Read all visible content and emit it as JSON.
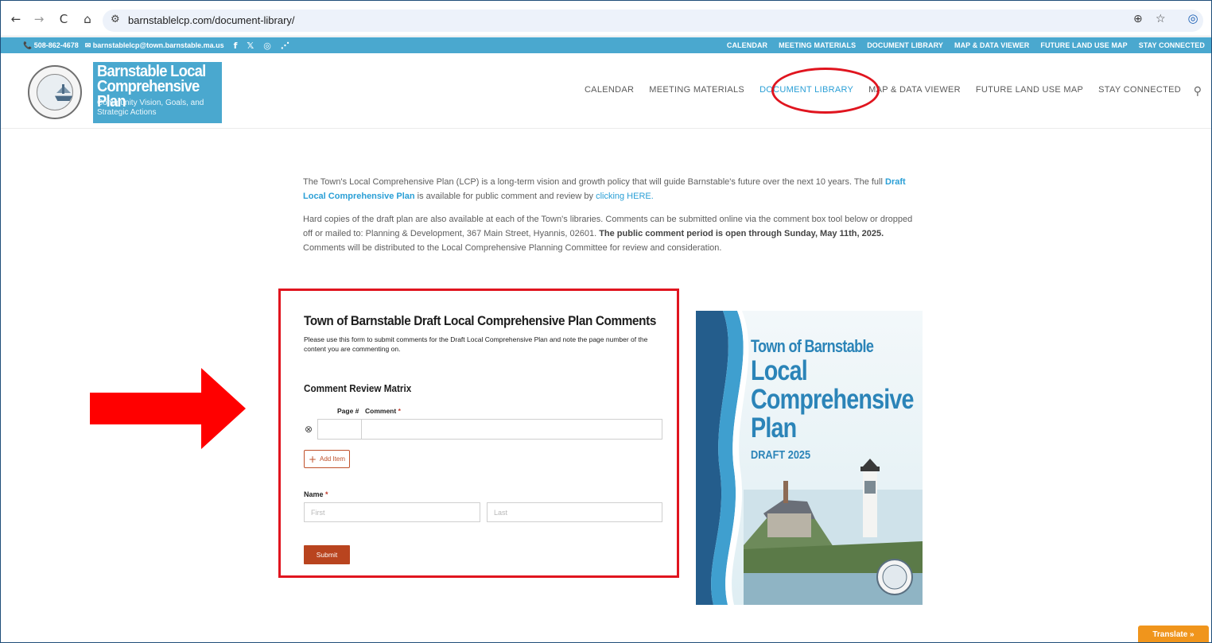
{
  "browser": {
    "url": "barnstablelcp.com/document-library/",
    "back_icon": "←",
    "forward_icon": "→",
    "reload_icon": "C",
    "home_icon": "⌂",
    "site_info_icon": "⚙",
    "zoom_icon": "⊕",
    "bookmark_icon": "☆",
    "profile_icon": "◎"
  },
  "topbar": {
    "phone": "📞 508-862-4678",
    "email": "✉ barnstablelcp@town.barnstable.ma.us",
    "social_facebook": "f",
    "social_x": "𝕏",
    "social_instagram": "◎",
    "social_rss": "⋰",
    "links": [
      "CALENDAR",
      "MEETING MATERIALS",
      "DOCUMENT LIBRARY",
      "MAP & DATA VIEWER",
      "FUTURE LAND USE MAP",
      "STAY CONNECTED"
    ]
  },
  "header": {
    "logo_title": "Barnstable Local Comprehensive Plan",
    "logo_subtitle": "Community Vision, Goals, and Strategic Actions",
    "nav": [
      "CALENDAR",
      "MEETING MATERIALS",
      "DOCUMENT LIBRARY",
      "MAP & DATA VIEWER",
      "FUTURE LAND USE MAP",
      "STAY CONNECTED"
    ],
    "active_nav": "DOCUMENT LIBRARY",
    "search_icon": "⚲"
  },
  "intro": {
    "p1_a": "The Town's Local Comprehensive Plan (LCP) is a long-term vision and growth policy that will guide Barnstable's future over the next 10 years. The full ",
    "p1_link": "Draft Local Comprehensive Plan",
    "p1_b": " is available for public comment and review by ",
    "p1_link2": "clicking HERE.",
    "p2_a": "Hard copies of the draft plan are also available at each of the Town's libraries. Comments can be submitted online via the comment box tool below or dropped off or mailed to: Planning & Development, 367 Main Street, Hyannis, 02601. ",
    "p2_bold": "The public comment period is open through Sunday, May 11th, 2025.",
    "p2_b": " Comments will be distributed to the Local Comprehensive Planning Committee for review and consideration."
  },
  "form": {
    "title": "Town of Barnstable Draft Local Comprehensive Plan Comments",
    "description": "Please use this form to submit comments for the Draft Local Comprehensive Plan and note the page number of the content you are commenting on.",
    "matrix_title": "Comment Review Matrix",
    "col_page": "Page #",
    "col_comment": "Comment",
    "required_mark": "*",
    "remove_icon": "⊗",
    "add_item_label": "Add Item",
    "add_item_icon": "+",
    "name_label": "Name",
    "first_placeholder": "First",
    "last_placeholder": "Last",
    "submit_label": "Submit"
  },
  "cover": {
    "town": "Town of Barnstable",
    "title_l1": "Local",
    "title_l2": "Comprehensive",
    "title_l3": "Plan",
    "draft": "DRAFT 2025"
  },
  "translate_label": "Translate »",
  "colors": {
    "accent": "#4aa8cf",
    "link": "#2a9fd6",
    "highlight": "#e0151f",
    "button": "#b9441f",
    "translate": "#f0951c"
  }
}
